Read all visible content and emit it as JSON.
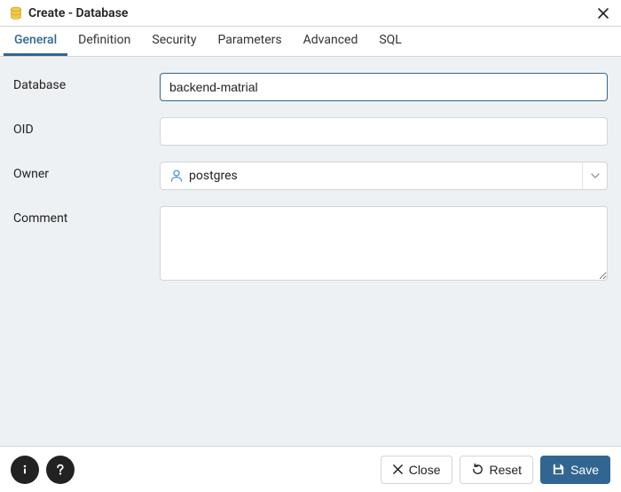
{
  "title": "Create - Database",
  "tabs": [
    {
      "label": "General"
    },
    {
      "label": "Definition"
    },
    {
      "label": "Security"
    },
    {
      "label": "Parameters"
    },
    {
      "label": "Advanced"
    },
    {
      "label": "SQL"
    }
  ],
  "active_tab_index": 0,
  "form": {
    "database": {
      "label": "Database",
      "value": "backend-matrial"
    },
    "oid": {
      "label": "OID",
      "value": ""
    },
    "owner": {
      "label": "Owner",
      "value": "postgres"
    },
    "comment": {
      "label": "Comment",
      "value": ""
    }
  },
  "footer": {
    "close": "Close",
    "reset": "Reset",
    "save": "Save"
  }
}
